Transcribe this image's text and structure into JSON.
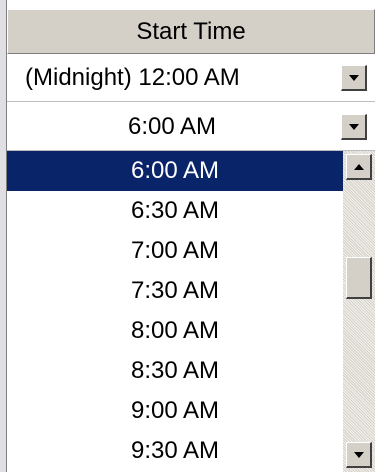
{
  "header": {
    "label": "Start Time"
  },
  "fields": [
    {
      "value": "(Midnight) 12:00 AM",
      "button_icon": "dropdown-arrow-icon"
    },
    {
      "value": "6:00 AM",
      "button_icon": "dropdown-arrow-icon"
    }
  ],
  "dropdown": {
    "items": [
      "6:00 AM",
      "6:30 AM",
      "7:00 AM",
      "7:30 AM",
      "8:00 AM",
      "8:30 AM",
      "9:00 AM",
      "9:30 AM"
    ],
    "selected": "6:00 AM",
    "scroll_position": 0.35
  },
  "colors": {
    "selection": "#0a246a",
    "face": "#d4d0c8"
  }
}
